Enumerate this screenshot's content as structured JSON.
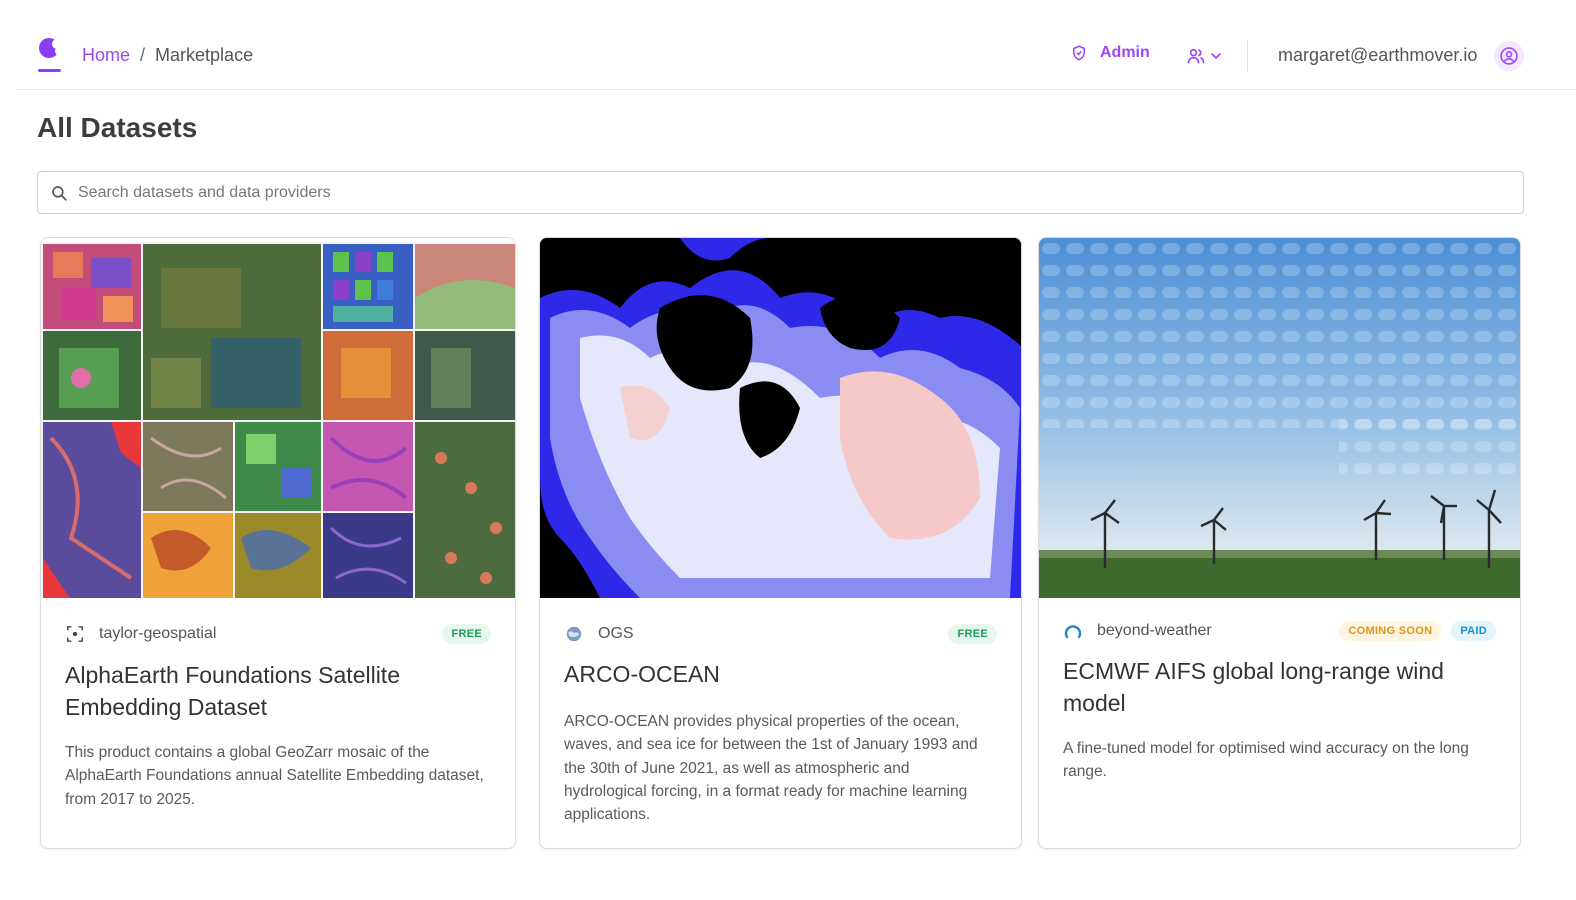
{
  "header": {
    "breadcrumb": {
      "home": "Home",
      "separator": "/",
      "current": "Marketplace"
    },
    "admin_label": "Admin",
    "email": "margaret@earthmover.io",
    "icons": [
      "logo-icon",
      "shield-icon",
      "users-icon",
      "chevron-down-icon",
      "user-circle-icon"
    ],
    "accent_color": "#9b47f5"
  },
  "page": {
    "title": "All Datasets",
    "search": {
      "placeholder": "Search datasets and data providers",
      "value": ""
    }
  },
  "datasets": [
    {
      "provider": "taylor-geospatial",
      "badges": [
        "FREE"
      ],
      "title": "AlphaEarth Foundations Satellite Embedding Dataset",
      "description": "This product contains a global GeoZarr mosaic of the AlphaEarth Foundations annual Satellite Embedding dataset, from 2017 to 2025."
    },
    {
      "provider": "OGS",
      "badges": [
        "FREE"
      ],
      "title": "ARCO-OCEAN",
      "description": "ARCO-OCEAN provides physical properties of the ocean, waves, and sea ice for between the 1st of January 1993 and the 30th of June 2021, as well as atmospheric and hydrological forcing, in a format ready for machine learning applications."
    },
    {
      "provider": "beyond-weather",
      "badges": [
        "COMING SOON",
        "PAID"
      ],
      "title": "ECMWF AIFS global long-range wind model",
      "description": "A fine-tuned model for optimised wind accuracy on the long range."
    }
  ]
}
